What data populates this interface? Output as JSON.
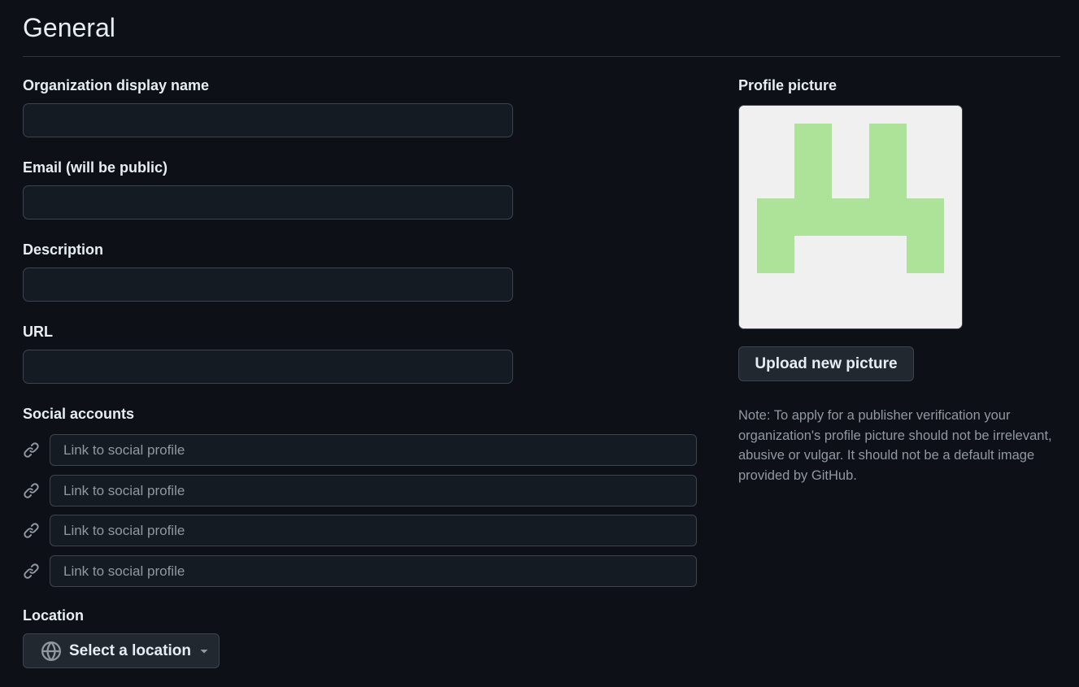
{
  "page": {
    "title": "General"
  },
  "form": {
    "display_name": {
      "label": "Organization display name",
      "value": ""
    },
    "email": {
      "label": "Email (will be public)",
      "value": ""
    },
    "description": {
      "label": "Description",
      "value": ""
    },
    "url": {
      "label": "URL",
      "value": ""
    },
    "social": {
      "label": "Social accounts",
      "icon": "link-icon",
      "accounts": [
        {
          "placeholder": "Link to social profile",
          "value": ""
        },
        {
          "placeholder": "Link to social profile",
          "value": ""
        },
        {
          "placeholder": "Link to social profile",
          "value": ""
        },
        {
          "placeholder": "Link to social profile",
          "value": ""
        }
      ]
    },
    "location": {
      "label": "Location",
      "button_label": "Select a location",
      "icon": "globe-icon",
      "caret_icon": "triangle-down-icon"
    }
  },
  "profile_picture": {
    "label": "Profile picture",
    "upload_label": "Upload new picture",
    "avatar_background": "#f0f0f0",
    "avatar_color": "#ade398",
    "note": "Note: To apply for a publisher verification your organization's profile picture should not be irrelevant, abusive or vulgar. It should not be a default image provided by GitHub."
  },
  "colors": {
    "background": "#0d1117",
    "input_background": "#151b23",
    "border": "#3d444d",
    "text": "#e6edf3",
    "muted_text": "#9198a1"
  }
}
